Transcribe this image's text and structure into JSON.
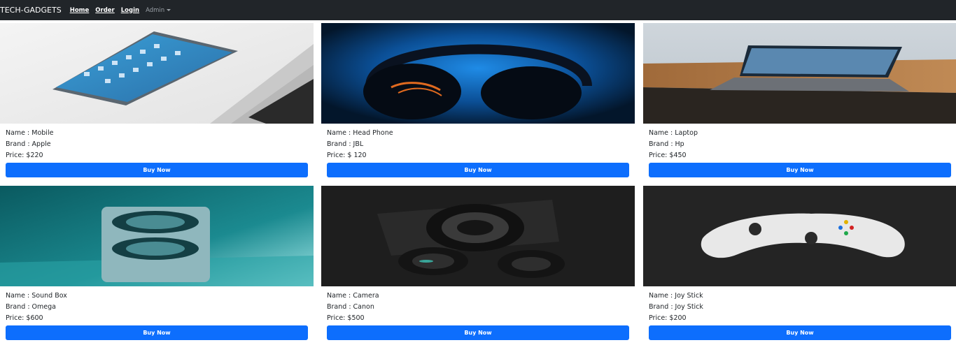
{
  "navbar": {
    "brand": "TECH-GADGETS",
    "links": [
      "Home",
      "Order",
      "Login"
    ],
    "admin": "Admin"
  },
  "products": [
    {
      "name": "Name : Mobile",
      "brand": "Brand : Apple",
      "price": "Price: $220",
      "button": "Buy Now"
    },
    {
      "name": "Name : Head Phone",
      "brand": "Brand : JBL",
      "price": "Price: $ 120",
      "button": "Buy Now"
    },
    {
      "name": "Name : Laptop",
      "brand": "Brand : Hp",
      "price": "Price: $450",
      "button": "Buy Now"
    },
    {
      "name": "Name : Sound Box",
      "brand": "Brand : Omega",
      "price": "Price: $600",
      "button": "Buy Now"
    },
    {
      "name": "Name : Camera",
      "brand": "Brand : Canon",
      "price": "Price: $500",
      "button": "Buy Now"
    },
    {
      "name": "Name : Joy Stick",
      "brand": "Brand : Joy Stick",
      "price": "Price: $200",
      "button": "Buy Now"
    }
  ],
  "colors": {
    "navbar_bg": "#212529",
    "button_bg": "#0d6efd"
  }
}
